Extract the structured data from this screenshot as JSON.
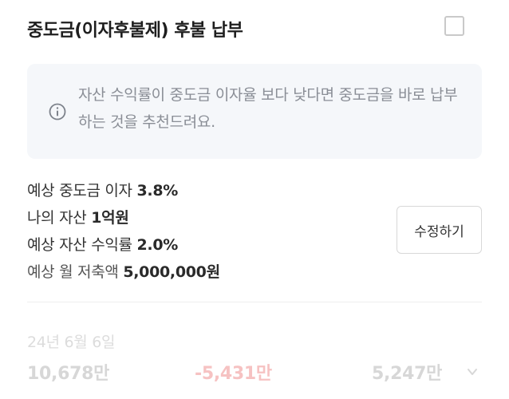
{
  "header": {
    "title": "중도금(이자후불제) 후불 납부",
    "checkbox_checked": false
  },
  "info": {
    "icon": "info-circle-icon",
    "text": "자산 수익률이 중도금 이자율 보다 낮다면 중도금을 바로 납부하는 것을 추천드려요."
  },
  "summary": {
    "rows": [
      {
        "label": "예상 중도금 이자",
        "value": "3.8%"
      },
      {
        "label": "나의 자산",
        "value": "1억원"
      },
      {
        "label": "예상 자산 수익률",
        "value": "2.0%"
      },
      {
        "label": "예상 월 저축액",
        "value": "5,000,000원"
      }
    ],
    "edit_button_label": "수정하기"
  },
  "stats": {
    "date": "24년 6월 6일",
    "asset": "10,678만",
    "difference": "-5,431만",
    "result": "5,247만"
  },
  "colors": {
    "info_bg": "#f5f7fa",
    "negative": "#f6c2c2",
    "muted": "#d7d7d7"
  }
}
